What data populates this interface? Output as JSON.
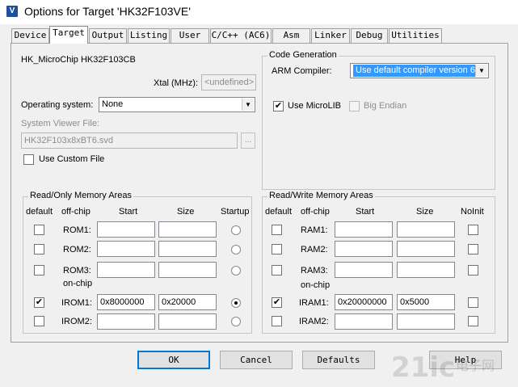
{
  "window": {
    "icon_glyph": "V",
    "title": "Options for Target 'HK32F103VE'"
  },
  "tabs": [
    {
      "label": "Device"
    },
    {
      "label": "Target",
      "active": true
    },
    {
      "label": "Output"
    },
    {
      "label": "Listing"
    },
    {
      "label": "User"
    },
    {
      "label": "C/C++ (AC6)"
    },
    {
      "label": "Asm"
    },
    {
      "label": "Linker"
    },
    {
      "label": "Debug"
    },
    {
      "label": "Utilities"
    }
  ],
  "device": {
    "name": "HK_MicroChip HK32F103CB",
    "xtal_label": "Xtal (MHz):",
    "xtal_value": "<undefined>",
    "os_label": "Operating system:",
    "os_value": "None",
    "svd_label": "System Viewer File:",
    "svd_value": "HK32F103x8xBT6.svd",
    "browse_label": "...",
    "custom_file_label": "Use Custom File"
  },
  "codegen": {
    "title": "Code Generation",
    "compiler_label": "ARM Compiler:",
    "compiler_value": "Use default compiler version 6",
    "microlib_label": "Use MicroLIB",
    "microlib_checked": true,
    "big_endian_label": "Big Endian",
    "big_endian_checked": false
  },
  "rom": {
    "title": "Read/Only Memory Areas",
    "headers": {
      "default": "default",
      "offchip": "off-chip",
      "start": "Start",
      "size": "Size",
      "startup": "Startup"
    },
    "onchip_label": "on-chip",
    "rows": [
      {
        "name": "ROM1:",
        "default": false,
        "start": "",
        "size": "",
        "startup": false
      },
      {
        "name": "ROM2:",
        "default": false,
        "start": "",
        "size": "",
        "startup": false
      },
      {
        "name": "ROM3:",
        "default": false,
        "start": "",
        "size": "",
        "startup": false
      },
      {
        "name": "IROM1:",
        "default": true,
        "start": "0x8000000",
        "size": "0x20000",
        "startup": true
      },
      {
        "name": "IROM2:",
        "default": false,
        "start": "",
        "size": "",
        "startup": false
      }
    ]
  },
  "ram": {
    "title": "Read/Write Memory Areas",
    "headers": {
      "default": "default",
      "offchip": "off-chip",
      "start": "Start",
      "size": "Size",
      "noinit": "NoInit"
    },
    "onchip_label": "on-chip",
    "rows": [
      {
        "name": "RAM1:",
        "default": false,
        "start": "",
        "size": "",
        "noinit": false
      },
      {
        "name": "RAM2:",
        "default": false,
        "start": "",
        "size": "",
        "noinit": false
      },
      {
        "name": "RAM3:",
        "default": false,
        "start": "",
        "size": "",
        "noinit": false
      },
      {
        "name": "IRAM1:",
        "default": true,
        "start": "0x20000000",
        "size": "0x5000",
        "noinit": false
      },
      {
        "name": "IRAM2:",
        "default": false,
        "start": "",
        "size": "",
        "noinit": false
      }
    ]
  },
  "buttons": {
    "ok": "OK",
    "cancel": "Cancel",
    "defaults": "Defaults",
    "help": "Help"
  },
  "watermark": {
    "brand": "21ic",
    "caption": "电子网"
  },
  "icons": {
    "check": "✔",
    "dropdown": "▼"
  }
}
